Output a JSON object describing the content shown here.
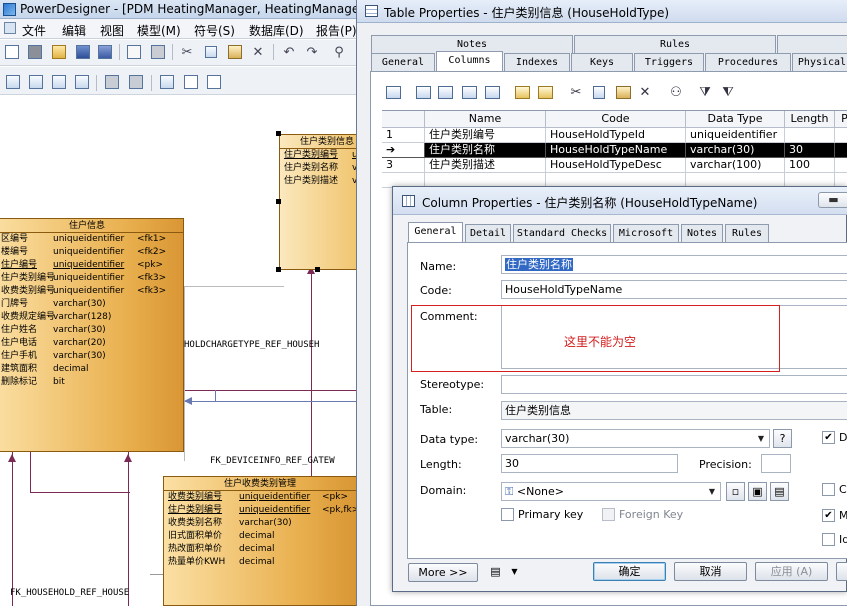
{
  "pd": {
    "title": "PowerDesigner - [PDM HeatingManager, HeatingManager",
    "menu": [
      "文件",
      "编辑",
      "视图",
      "模型(M)",
      "符号(S)",
      "数据库(D)",
      "报告(P)"
    ]
  },
  "entities": {
    "zhuhu": {
      "title": "住户信息",
      "rows": [
        {
          "name": "区编号",
          "type": "uniqueidentifier",
          "key": "<fk1>",
          "u": false
        },
        {
          "name": "楼编号",
          "type": "uniqueidentifier",
          "key": "<fk2>",
          "u": false
        },
        {
          "name": "住户编号",
          "type": "uniqueidentifier",
          "key": "<pk>",
          "u": true
        },
        {
          "name": "住户类别编号",
          "type": "uniqueidentifier",
          "key": "<fk3>",
          "u": false
        },
        {
          "name": "收费类别编号",
          "type": "uniqueidentifier",
          "key": "<fk3>",
          "u": false
        },
        {
          "name": "门牌号",
          "type": "varchar(30)",
          "key": "",
          "u": false
        },
        {
          "name": "收费规定编号",
          "type": "varchar(128)",
          "key": "",
          "u": false
        },
        {
          "name": "住户姓名",
          "type": "varchar(30)",
          "key": "",
          "u": false
        },
        {
          "name": "住户电话",
          "type": "varchar(20)",
          "key": "",
          "u": false
        },
        {
          "name": "住户手机",
          "type": "varchar(30)",
          "key": "",
          "u": false
        },
        {
          "name": "建筑面积",
          "type": "decimal",
          "key": "",
          "u": false
        },
        {
          "name": "删除标记",
          "type": "bit",
          "key": "",
          "u": false
        }
      ]
    },
    "leibie": {
      "title": "住户类别信息",
      "rows": [
        {
          "name": "住户类别编号",
          "type": "u",
          "key": "",
          "u": true
        },
        {
          "name": "住户类别名称",
          "type": "v",
          "key": "",
          "u": false
        },
        {
          "name": "住户类别描述",
          "type": "v",
          "key": "",
          "u": false
        }
      ]
    },
    "shoufei": {
      "title": "住户收费类别管理",
      "rows": [
        {
          "name": "收费类别编号",
          "type": "uniqueidentifier",
          "key": "<pk>",
          "u": true
        },
        {
          "name": "住户类别编号",
          "type": "uniqueidentifier",
          "key": "<pk,fk>",
          "u": true
        },
        {
          "name": "收费类别名称",
          "type": "varchar(30)",
          "key": "",
          "u": false
        },
        {
          "name": "旧式面积单价",
          "type": "decimal",
          "key": "",
          "u": false
        },
        {
          "name": "热改面积单价",
          "type": "decimal",
          "key": "",
          "u": false
        },
        {
          "name": "热量单价KWH",
          "type": "decimal",
          "key": "",
          "u": false
        }
      ]
    }
  },
  "refs": {
    "r1": "HOLDCHARGETYPE_REF_HOUSEH",
    "r2": "FK_DEVICEINFO_REF_GATEW",
    "r3": "FK_HOUSEHOLD_REF_HOUSE"
  },
  "tp": {
    "title": "Table Properties - 住户类别信息 (HouseHoldType)",
    "tabs_top": [
      "Notes",
      "Rules"
    ],
    "tabs": [
      "General",
      "Columns",
      "Indexes",
      "Keys",
      "Triggers",
      "Procedures",
      "Physical"
    ],
    "grid_headers": [
      "Name",
      "Code",
      "Data Type",
      "Length",
      "P"
    ],
    "grid_rows": [
      {
        "num": "1",
        "name": "住户类别编号",
        "code": "HouseHoldTypeId",
        "type": "uniqueidentifier",
        "length": ""
      },
      {
        "num": "➔",
        "name": "住户类别名称",
        "code": "HouseHoldTypeName",
        "type": "varchar(30)",
        "length": "30"
      },
      {
        "num": "3",
        "name": "住户类别描述",
        "code": "HouseHoldTypeDesc",
        "type": "varchar(100)",
        "length": "100"
      }
    ]
  },
  "cp": {
    "title": "Column Properties - 住户类别名称 (HouseHoldTypeName)",
    "tabs": [
      "General",
      "Detail",
      "Standard Checks",
      "Microsoft",
      "Notes",
      "Rules"
    ],
    "labels": {
      "name": "Name:",
      "code": "Code:",
      "comment": "Comment:",
      "stereotype": "Stereotype:",
      "table": "Table:",
      "datatype": "Data type:",
      "length": "Length:",
      "precision": "Precision:",
      "domain": "Domain:"
    },
    "values": {
      "name": "住户类别名称",
      "code": "HouseHoldTypeName",
      "table": "住户类别信息",
      "datatype": "varchar(30)",
      "length": "30",
      "domain": "<None>"
    },
    "checks": {
      "primary": "Primary key",
      "foreign": "Foreign Key",
      "r1": "Di",
      "r2": "Co",
      "r3": "M",
      "r4": "Id"
    },
    "buttons": {
      "more": "More >>",
      "ok": "确定",
      "cancel": "取消",
      "apply": "应用 (A)",
      "help": "?"
    },
    "annotation": "这里不能为空"
  }
}
